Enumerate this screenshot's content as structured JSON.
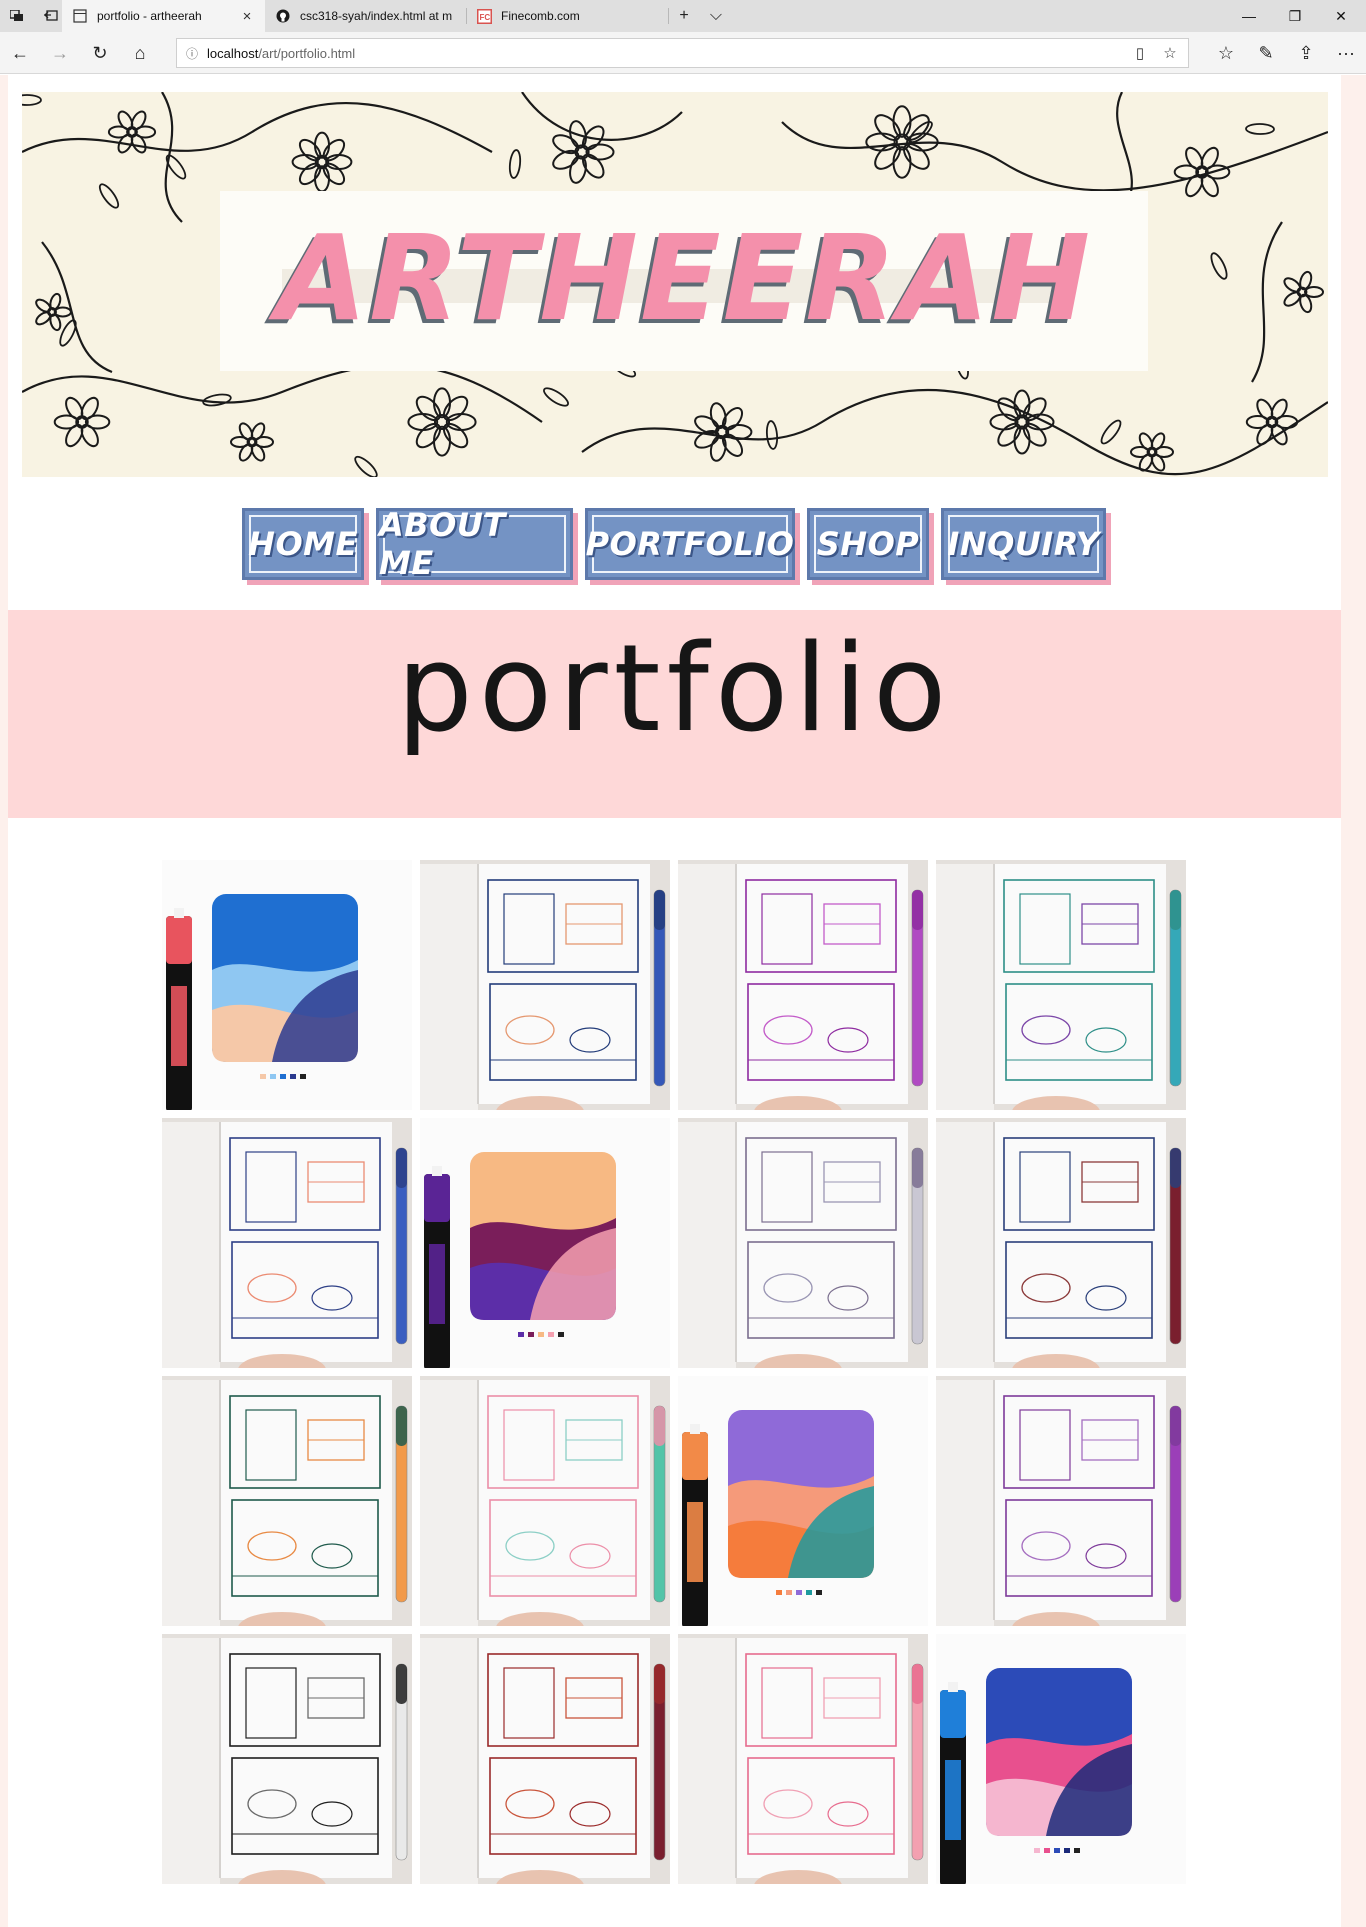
{
  "browser": {
    "tabs": [
      {
        "label": "portfolio - artheerah",
        "active": true,
        "icon": "page-icon"
      },
      {
        "label": "csc318-syah/index.html at m",
        "active": false,
        "icon": "github-icon"
      },
      {
        "label": "Finecomb.com",
        "active": false,
        "icon": "finecomb-icon"
      }
    ],
    "address": {
      "host": "localhost",
      "path": "/art/portfolio.html"
    },
    "icons": {
      "tab_close": "×",
      "new_tab": "+",
      "tab_list": "⌵",
      "minimize": "—",
      "restore": "❐",
      "close": "✕",
      "back": "←",
      "forward": "→",
      "refresh": "↻",
      "home": "⌂",
      "info": "ⓘ",
      "reading_view": "▯",
      "favorite": "☆",
      "favorites_hub": "☆",
      "notes": "✎",
      "share": "⇪",
      "more": "···"
    }
  },
  "site": {
    "logo": "ARTHEERAH",
    "nav": [
      {
        "label": "HOME"
      },
      {
        "label": "ABOUT ME"
      },
      {
        "label": "PORTFOLIO"
      },
      {
        "label": "SHOP"
      },
      {
        "label": "INQUIRY"
      }
    ],
    "page_title": "portfolio"
  },
  "gallery": {
    "items": [
      {
        "kind": "card",
        "marker": "#e8545e",
        "palette": [
          "#1f6fd1",
          "#8fc7f2",
          "#f5c8a8",
          "#2b3a8f"
        ]
      },
      {
        "kind": "book",
        "ink": "#233c7a",
        "accent": "#e59870",
        "pen": "#3558b8"
      },
      {
        "kind": "book",
        "ink": "#8e2ba0",
        "accent": "#c35cc9",
        "pen": "#b04ac2"
      },
      {
        "kind": "book",
        "ink": "#2e8f88",
        "accent": "#7c47a8",
        "pen": "#35a8b8"
      },
      {
        "kind": "book",
        "ink": "#2d3f86",
        "accent": "#eb8b72",
        "pen": "#3a5ec0"
      },
      {
        "kind": "card",
        "marker": "#5a2495",
        "palette": [
          "#f7b983",
          "#7a1e5a",
          "#5c2ea8",
          "#f4a0b0"
        ]
      },
      {
        "kind": "book",
        "ink": "#7b6f8f",
        "accent": "#9a96b4",
        "pen": "#c9c7d3"
      },
      {
        "kind": "book",
        "ink": "#2a3f7a",
        "accent": "#8b3a3a",
        "pen": "#7a1f2e"
      },
      {
        "kind": "book",
        "ink": "#1f5a4c",
        "accent": "#e88a44",
        "pen": "#f29a4a"
      },
      {
        "kind": "book",
        "ink": "#ec8ea8",
        "accent": "#8ccfc6",
        "pen": "#52c4a8"
      },
      {
        "kind": "card",
        "marker": "#f28a48",
        "palette": [
          "#8f6ad8",
          "#f59a7a",
          "#f57c3c",
          "#1e9a9e"
        ]
      },
      {
        "kind": "book",
        "ink": "#7e3a9a",
        "accent": "#a56ec0",
        "pen": "#9b3fb8"
      },
      {
        "kind": "book",
        "ink": "#1e1e1e",
        "accent": "#6a6a6a",
        "pen": "#e9e9e9"
      },
      {
        "kind": "book",
        "ink": "#9a2a2a",
        "accent": "#c9553b",
        "pen": "#7a1f2e"
      },
      {
        "kind": "book",
        "ink": "#e76c8e",
        "accent": "#f0a0b4",
        "pen": "#f3a0b0"
      },
      {
        "kind": "card",
        "marker": "#1f7fd9",
        "palette": [
          "#2c4bb8",
          "#e8508e",
          "#f5b6cf",
          "#1b2a7a"
        ]
      }
    ]
  },
  "colors": {
    "page_bg": "#fdf0ec",
    "logo_pink": "#f490ab",
    "nav_blue": "#7493c4",
    "nav_shadow_pink": "#f0a3b8",
    "banner_pink": "#fed8d8"
  }
}
